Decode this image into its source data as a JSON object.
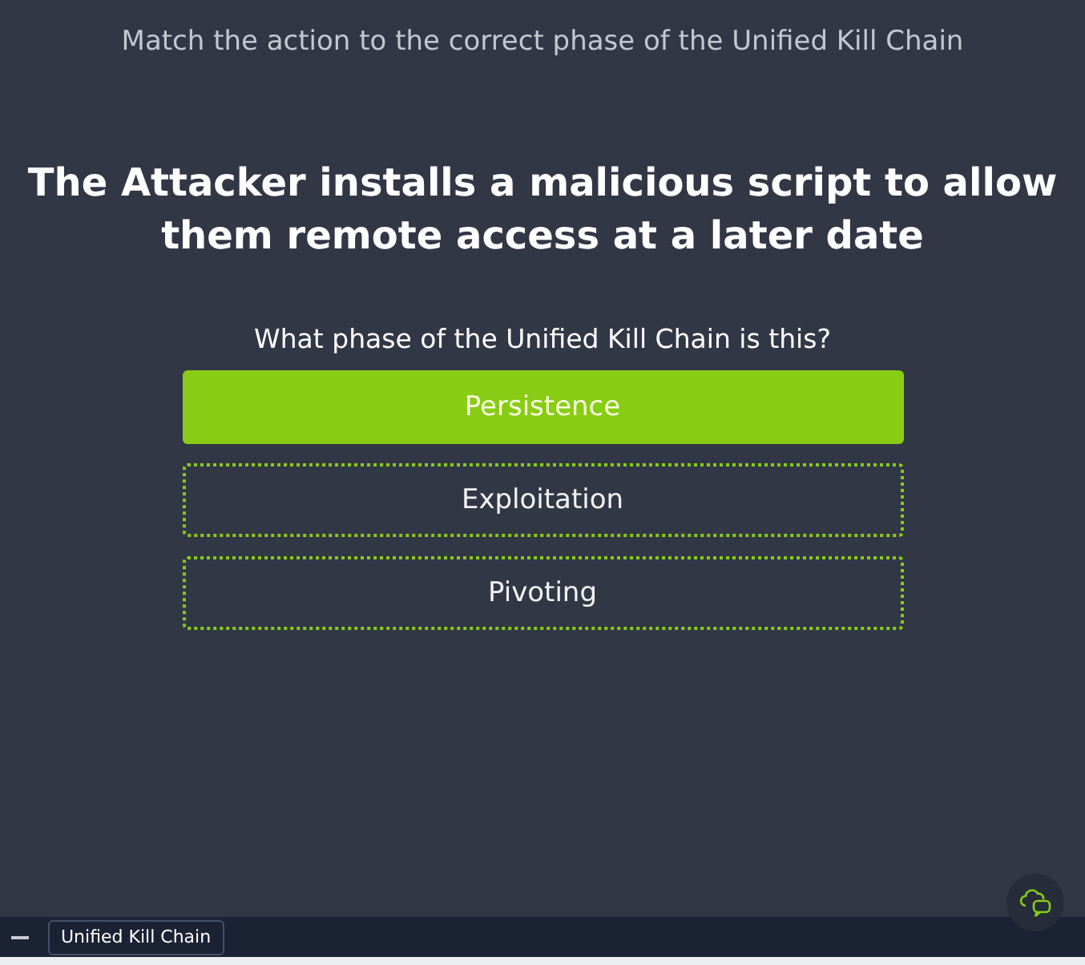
{
  "header": {
    "instruction": "Match the action to the correct phase of the Unified Kill Chain"
  },
  "question": {
    "statement": "The Attacker installs a malicious script to allow them remote access at a later date",
    "prompt": "What phase of the Unified Kill Chain is this?"
  },
  "options": [
    {
      "label": "Persistence",
      "selected": true
    },
    {
      "label": "Exploitation",
      "selected": false
    },
    {
      "label": "Pivoting",
      "selected": false
    }
  ],
  "taskbar": {
    "tab": "Unified Kill Chain"
  }
}
